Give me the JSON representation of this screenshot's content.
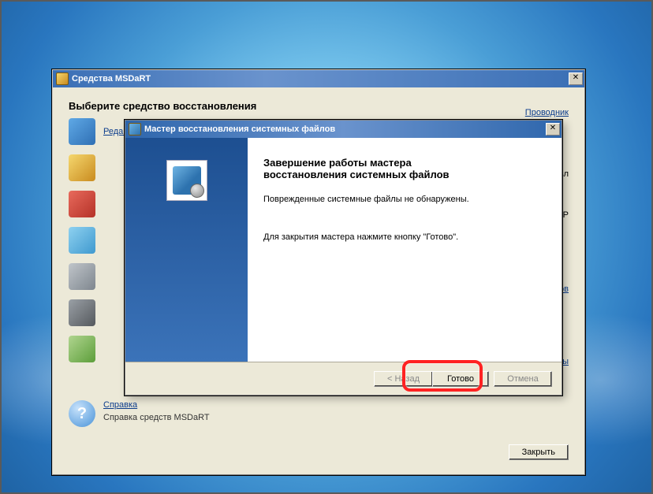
{
  "parent_window": {
    "title": "Средства MSDaRT",
    "heading": "Выберите средство восстановления",
    "tools_left": [
      "Редактор реестра ERD"
    ],
    "tools_right": [
      "Проводник"
    ],
    "fragments": {
      "anovl": "ановл",
      "tcp": "и TCP",
      "lov": "лов",
      "stemy": "стемы"
    },
    "help": {
      "link": "Справка",
      "desc": "Справка средств MSDaRT"
    },
    "close_btn": "Закрыть"
  },
  "wizard": {
    "title": "Мастер восстановления системных файлов",
    "heading_line1": "Завершение работы мастера",
    "heading_line2": "восстановления системных файлов",
    "msg1": "Поврежденные системные файлы не обнаружены.",
    "msg2": "Для закрытия мастера нажмите кнопку \"Готово\".",
    "buttons": {
      "back": "< Назад",
      "finish": "Готово",
      "cancel": "Отмена"
    }
  }
}
